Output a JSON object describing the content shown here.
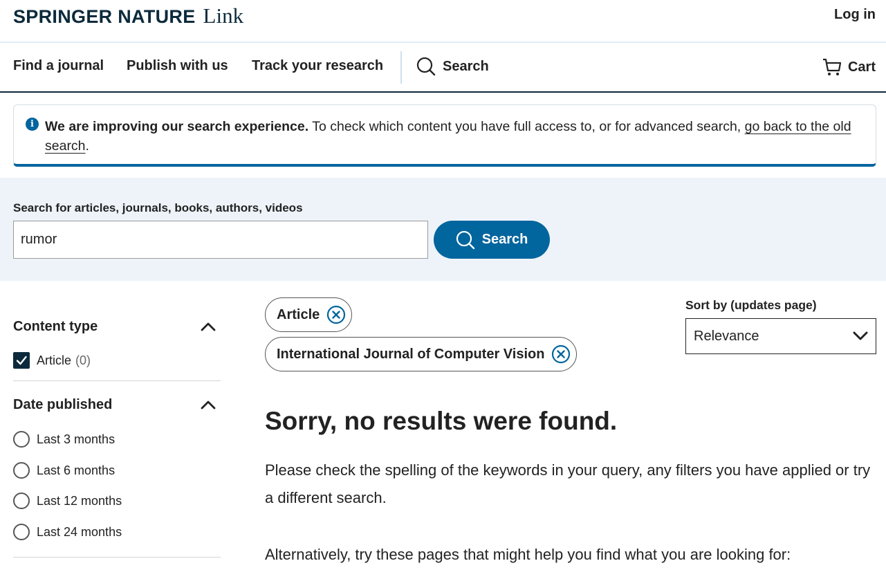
{
  "header": {
    "brand": "SPRINGER NATURE",
    "product": "Link",
    "login_label": "Log in"
  },
  "nav": {
    "items": [
      {
        "label": "Find a journal"
      },
      {
        "label": "Publish with us"
      },
      {
        "label": "Track your research"
      }
    ],
    "search_label": "Search",
    "cart_label": "Cart"
  },
  "notice": {
    "bold": "We are improving our search experience.",
    "text": " To check which content you have full access to, or for advanced search, ",
    "link": "go back to the old search",
    "end": "."
  },
  "search": {
    "label": "Search for articles, journals, books, authors, videos",
    "value": "rumor",
    "button_label": "Search"
  },
  "filters": {
    "content_type": {
      "heading": "Content type",
      "options": [
        {
          "label": "Article",
          "count": "(0)",
          "checked": true
        }
      ]
    },
    "date_published": {
      "heading": "Date published",
      "options": [
        {
          "label": "Last 3 months"
        },
        {
          "label": "Last 6 months"
        },
        {
          "label": "Last 12 months"
        },
        {
          "label": "Last 24 months"
        }
      ]
    }
  },
  "active_filters": [
    {
      "label": "Article"
    },
    {
      "label": "International Journal of Computer Vision"
    }
  ],
  "sort": {
    "label": "Sort by (updates page)",
    "value": "Relevance"
  },
  "results": {
    "heading": "Sorry, no results were found.",
    "message": "Please check the spelling of the keywords in your query, any filters you have applied or try a different search.",
    "alternative": "Alternatively, try these pages that might help you find what you are looking for:"
  },
  "colors": {
    "brand_dark": "#0c2a3b",
    "accent_blue": "#01659e",
    "search_band": "#edf3f9"
  }
}
